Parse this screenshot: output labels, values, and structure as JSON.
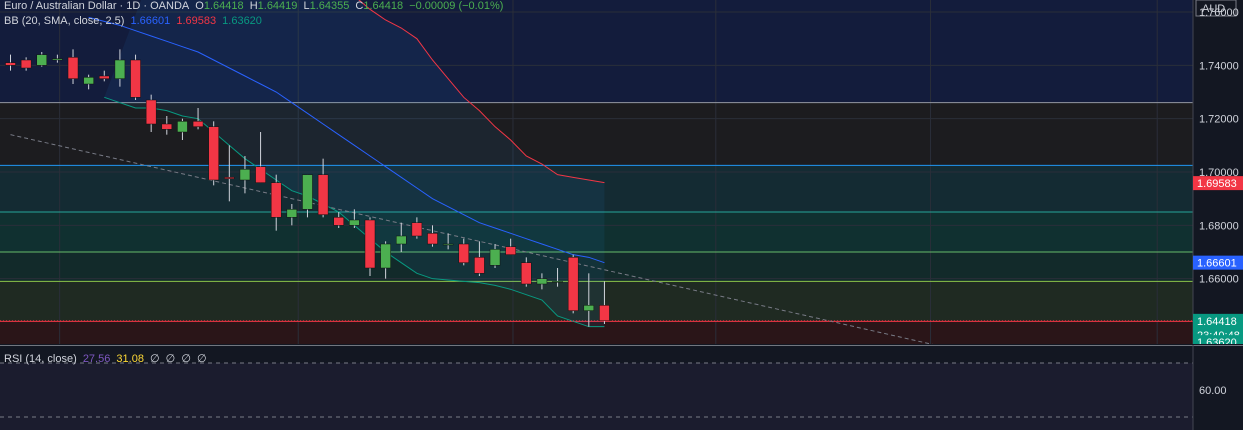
{
  "header": {
    "symbol": "Euro / Australian Dollar · 1D · OANDA",
    "open_label": "O",
    "open": "1.64418",
    "high_label": "H",
    "high": "1.64419",
    "low_label": "L",
    "low": "1.64355",
    "close_label": "C",
    "close": "1.64418",
    "change": "−0.00009 (−0.01%)"
  },
  "bb_legend": {
    "label": "BB (20, SMA, close, 2.5)",
    "basis": "1.66601",
    "upper": "1.69583",
    "lower": "1.63620"
  },
  "rsi_legend": {
    "label": "RSI (14, close)",
    "value1": "27.56",
    "value2": "31.08",
    "extras": [
      "∅",
      "∅",
      "∅",
      "∅"
    ]
  },
  "axis": {
    "currency": "AUD",
    "price_ticks": [
      "1.76000",
      "1.74000",
      "1.72000",
      "1.70000",
      "1.68000",
      "1.66000"
    ],
    "badges": {
      "upper": "1.69583",
      "basis": "1.66601",
      "last": "1.64418",
      "countdown": "23:40:48",
      "lower": "1.63620"
    },
    "rsi_tick": "60.00"
  },
  "colors": {
    "background": "#131722",
    "up": "#4caf50",
    "down": "#f23645",
    "bb_upper": "#f23645",
    "bb_basis": "#2962ff",
    "bb_lower": "#089981",
    "rsi": "#7e57c2",
    "rsi_ma": "#fdd835"
  },
  "chart_data": {
    "type": "candlestick",
    "ylim": [
      1.6355,
      1.7645
    ],
    "candles": [
      {
        "o": 1.741,
        "h": 1.744,
        "l": 1.738,
        "c": 1.74
      },
      {
        "o": 1.742,
        "h": 1.743,
        "l": 1.738,
        "c": 1.739
      },
      {
        "o": 1.74,
        "h": 1.745,
        "l": 1.7395,
        "c": 1.744
      },
      {
        "o": 1.742,
        "h": 1.744,
        "l": 1.741,
        "c": 1.7425
      },
      {
        "o": 1.743,
        "h": 1.746,
        "l": 1.733,
        "c": 1.735
      },
      {
        "o": 1.733,
        "h": 1.7365,
        "l": 1.731,
        "c": 1.7355
      },
      {
        "o": 1.736,
        "h": 1.738,
        "l": 1.734,
        "c": 1.735
      },
      {
        "o": 1.735,
        "h": 1.746,
        "l": 1.732,
        "c": 1.742
      },
      {
        "o": 1.742,
        "h": 1.744,
        "l": 1.727,
        "c": 1.728
      },
      {
        "o": 1.727,
        "h": 1.729,
        "l": 1.715,
        "c": 1.718
      },
      {
        "o": 1.718,
        "h": 1.721,
        "l": 1.714,
        "c": 1.716
      },
      {
        "o": 1.715,
        "h": 1.72,
        "l": 1.712,
        "c": 1.719
      },
      {
        "o": 1.719,
        "h": 1.724,
        "l": 1.716,
        "c": 1.717
      },
      {
        "o": 1.717,
        "h": 1.719,
        "l": 1.695,
        "c": 1.697
      },
      {
        "o": 1.698,
        "h": 1.71,
        "l": 1.689,
        "c": 1.6975
      },
      {
        "o": 1.697,
        "h": 1.706,
        "l": 1.692,
        "c": 1.701
      },
      {
        "o": 1.702,
        "h": 1.715,
        "l": 1.696,
        "c": 1.696
      },
      {
        "o": 1.696,
        "h": 1.699,
        "l": 1.678,
        "c": 1.683
      },
      {
        "o": 1.683,
        "h": 1.688,
        "l": 1.68,
        "c": 1.686
      },
      {
        "o": 1.686,
        "h": 1.699,
        "l": 1.683,
        "c": 1.699
      },
      {
        "o": 1.699,
        "h": 1.705,
        "l": 1.683,
        "c": 1.684
      },
      {
        "o": 1.683,
        "h": 1.685,
        "l": 1.679,
        "c": 1.68
      },
      {
        "o": 1.68,
        "h": 1.686,
        "l": 1.679,
        "c": 1.682
      },
      {
        "o": 1.682,
        "h": 1.683,
        "l": 1.661,
        "c": 1.664
      },
      {
        "o": 1.664,
        "h": 1.674,
        "l": 1.66,
        "c": 1.673
      },
      {
        "o": 1.673,
        "h": 1.681,
        "l": 1.67,
        "c": 1.676
      },
      {
        "o": 1.681,
        "h": 1.683,
        "l": 1.675,
        "c": 1.676
      },
      {
        "o": 1.677,
        "h": 1.68,
        "l": 1.672,
        "c": 1.673
      },
      {
        "o": 1.673,
        "h": 1.677,
        "l": 1.671,
        "c": 1.673
      },
      {
        "o": 1.673,
        "h": 1.675,
        "l": 1.665,
        "c": 1.666
      },
      {
        "o": 1.668,
        "h": 1.674,
        "l": 1.661,
        "c": 1.662
      },
      {
        "o": 1.665,
        "h": 1.673,
        "l": 1.664,
        "c": 1.671
      },
      {
        "o": 1.672,
        "h": 1.675,
        "l": 1.669,
        "c": 1.669
      },
      {
        "o": 1.666,
        "h": 1.668,
        "l": 1.657,
        "c": 1.658
      },
      {
        "o": 1.658,
        "h": 1.662,
        "l": 1.656,
        "c": 1.66
      },
      {
        "o": 1.659,
        "h": 1.664,
        "l": 1.657,
        "c": 1.659
      },
      {
        "o": 1.668,
        "h": 1.669,
        "l": 1.647,
        "c": 1.648
      },
      {
        "o": 1.648,
        "h": 1.662,
        "l": 1.642,
        "c": 1.65
      },
      {
        "o": 1.65,
        "h": 1.659,
        "l": 1.643,
        "c": 1.6442
      }
    ],
    "bb_upper": [
      1.79,
      1.788,
      1.786,
      1.784,
      1.782,
      1.78,
      1.779,
      1.779,
      1.778,
      1.777,
      1.774,
      1.771,
      1.766,
      1.761,
      1.757,
      1.754,
      1.75,
      1.742,
      1.735,
      1.728,
      1.723,
      1.717,
      1.712,
      1.706,
      1.703,
      1.699,
      1.698,
      1.697,
      1.696
    ],
    "bb_upper_start": 10,
    "bb_basis": [
      1.758,
      1.7565,
      1.755,
      1.753,
      1.751,
      1.749,
      1.747,
      1.745,
      1.742,
      1.739,
      1.736,
      1.733,
      1.73,
      1.726,
      1.722,
      1.718,
      1.714,
      1.71,
      1.706,
      1.702,
      1.698,
      1.694,
      1.69,
      1.687,
      1.684,
      1.681,
      1.679,
      1.677,
      1.675,
      1.673,
      1.671,
      1.669,
      1.668,
      1.666
    ],
    "bb_basis_start": 5,
    "bb_lower": [
      1.728,
      1.726,
      1.724,
      1.724,
      1.723,
      1.721,
      1.72,
      1.715,
      1.71,
      1.705,
      1.701,
      1.697,
      1.693,
      1.691,
      1.688,
      1.685,
      1.68,
      1.675,
      1.67,
      1.666,
      1.662,
      1.66,
      1.6595,
      1.659,
      1.6585,
      1.6575,
      1.656,
      1.654,
      1.652,
      1.646,
      1.644,
      1.642,
      1.642
    ],
    "bb_lower_start": 6,
    "trendline": [
      [
        1.714,
        0
      ],
      [
        1.63,
        63
      ]
    ],
    "levels": [
      1.726,
      1.7025,
      1.685,
      1.67,
      1.659,
      1.644
    ],
    "rsi": {
      "ylim": [
        25,
        75
      ],
      "levels": [
        70,
        60,
        30
      ]
    }
  }
}
